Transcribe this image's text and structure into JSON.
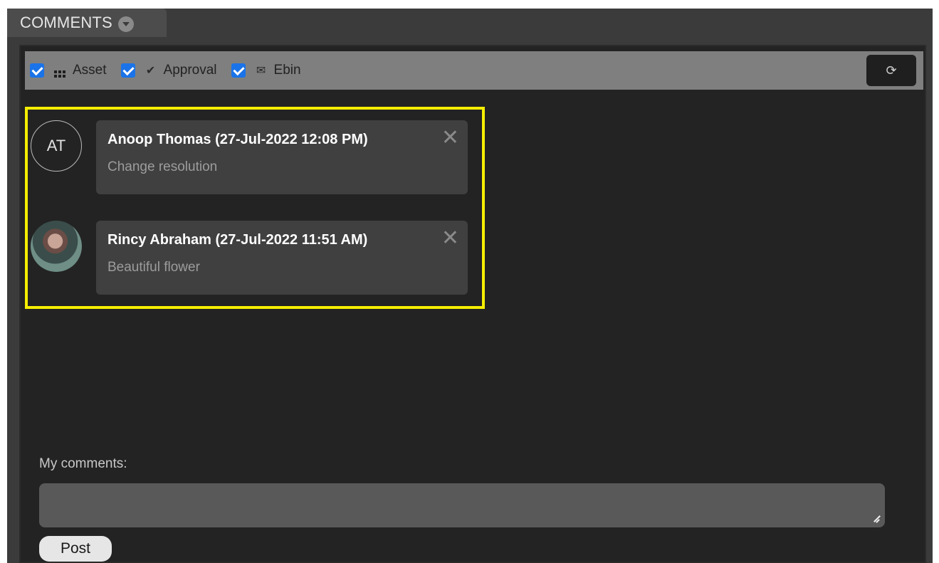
{
  "tab": {
    "title": "COMMENTS",
    "arrow_icon": "chevron-down-icon"
  },
  "filters": [
    {
      "label": "Asset",
      "checked": true,
      "icon": "grid-icon"
    },
    {
      "label": "Approval",
      "checked": true,
      "icon": "check-icon"
    },
    {
      "label": "Ebin",
      "checked": true,
      "icon": "mail-icon"
    }
  ],
  "refresh_icon": "refresh-icon",
  "highlight_color": "#f6ee00",
  "comments": [
    {
      "initials": "AT",
      "author": "Anoop Thomas (27-Jul-2022 12:08 PM)",
      "text": "Change resolution",
      "avatar_type": "initials"
    },
    {
      "initials": "",
      "author": "Rincy Abraham (27-Jul-2022 11:51 AM)",
      "text": "Beautiful flower",
      "avatar_type": "photo"
    }
  ],
  "composer": {
    "label": "My comments:",
    "value": "",
    "placeholder": "",
    "post_label": "Post"
  }
}
